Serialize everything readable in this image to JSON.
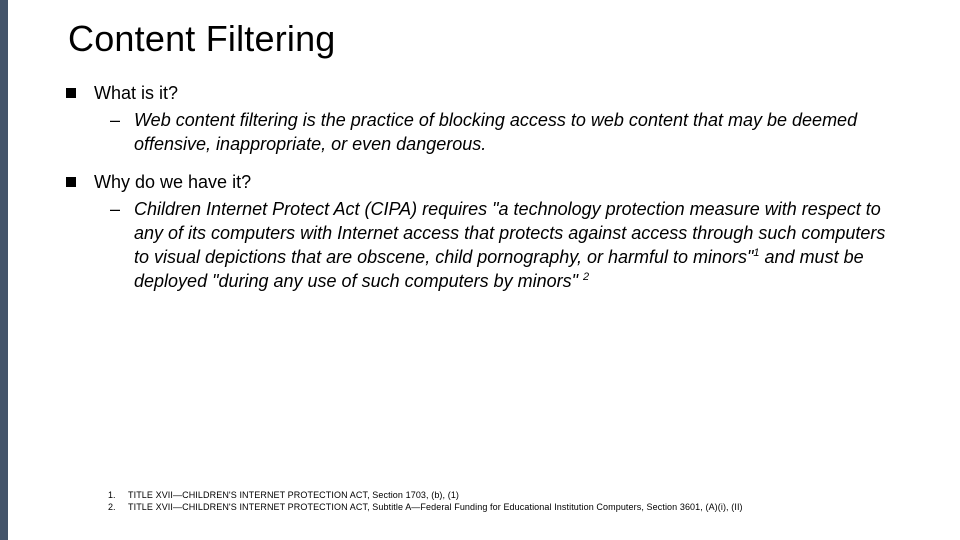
{
  "title": "Content Filtering",
  "bullets": [
    {
      "label": "What is it?",
      "subs": [
        {
          "text": "Web content filtering is the practice of blocking access to web content that may be deemed offensive, inappropriate, or even dangerous."
        }
      ]
    },
    {
      "label": "Why do we have it?",
      "subs": [
        {
          "text_a": "Children Internet Protect Act (CIPA) requires \"a technology protection measure with respect to any of its computers with Internet access that protects against access through such computers to visual depictions that are obscene, child pornography, or harmful to minors\"",
          "sup_a": "1",
          "text_b": " and must be deployed \"during any use of such computers by minors\" ",
          "sup_b": "2"
        }
      ]
    }
  ],
  "footnotes": [
    {
      "num": "1.",
      "text": "TITLE XVII—CHILDREN'S INTERNET PROTECTION ACT, Section 1703, (b), (1)"
    },
    {
      "num": "2.",
      "text": "TITLE XVII—CHILDREN'S INTERNET PROTECTION ACT, Subtitle A—Federal Funding for Educational Institution Computers, Section 3601, (A)(i), (II)"
    }
  ]
}
